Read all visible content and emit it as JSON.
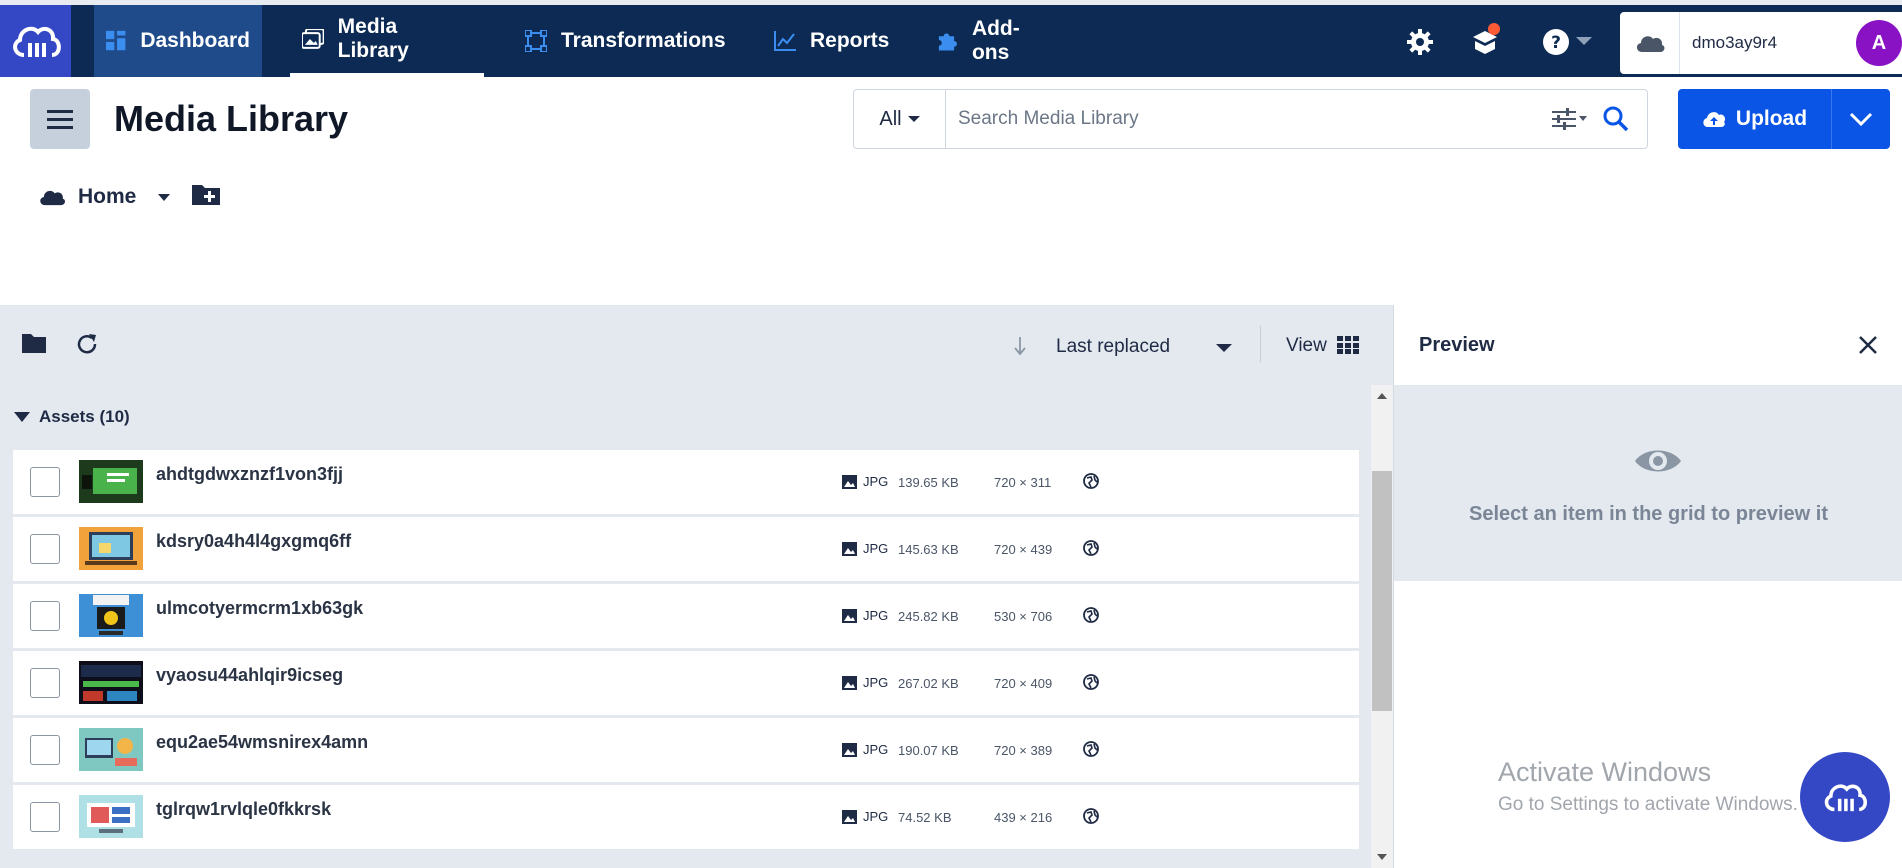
{
  "nav": {
    "items": [
      {
        "label": "Dashboard",
        "icon": "dashboard-icon"
      },
      {
        "label": "Media Library",
        "icon": "media-library-icon"
      },
      {
        "label": "Transformations",
        "icon": "transformations-icon"
      },
      {
        "label": "Reports",
        "icon": "reports-icon"
      },
      {
        "label": "Add-ons",
        "icon": "puzzle-icon"
      }
    ],
    "active": "Media Library"
  },
  "account": {
    "cloud_name": "dmo3ay9r4",
    "avatar_initial": "A"
  },
  "header": {
    "title": "Media Library"
  },
  "search": {
    "scope": "All",
    "placeholder": "Search Media Library"
  },
  "upload": {
    "label": "Upload"
  },
  "breadcrumb": {
    "root": "Home"
  },
  "toolbar": {
    "sort_label": "Last replaced",
    "view_label": "View"
  },
  "assets": {
    "header": "Assets (10)",
    "rows": [
      {
        "name": "ahdtgdwxznzf1von3fjj",
        "format": "JPG",
        "size": "139.65 KB",
        "dims": "720 × 311"
      },
      {
        "name": "kdsry0a4h4l4gxgmq6ff",
        "format": "JPG",
        "size": "145.63 KB",
        "dims": "720 × 439"
      },
      {
        "name": "ulmcotyermcrm1xb63gk",
        "format": "JPG",
        "size": "245.82 KB",
        "dims": "530 × 706"
      },
      {
        "name": "vyaosu44ahlqir9icseg",
        "format": "JPG",
        "size": "267.02 KB",
        "dims": "720 × 409"
      },
      {
        "name": "equ2ae54wmsnirex4amn",
        "format": "JPG",
        "size": "190.07 KB",
        "dims": "720 × 389"
      },
      {
        "name": "tglrqw1rvlqle0fkkrsk",
        "format": "JPG",
        "size": "74.52 KB",
        "dims": "439 × 216"
      }
    ]
  },
  "preview": {
    "title": "Preview",
    "empty_message": "Select an item in the grid to preview it"
  },
  "watermark": {
    "line1": "Activate Windows",
    "line2": "Go to Settings to activate Windows."
  },
  "colors": {
    "topbar": "#0c2a53",
    "accent": "#0a55e6",
    "brand": "#3448c5"
  }
}
